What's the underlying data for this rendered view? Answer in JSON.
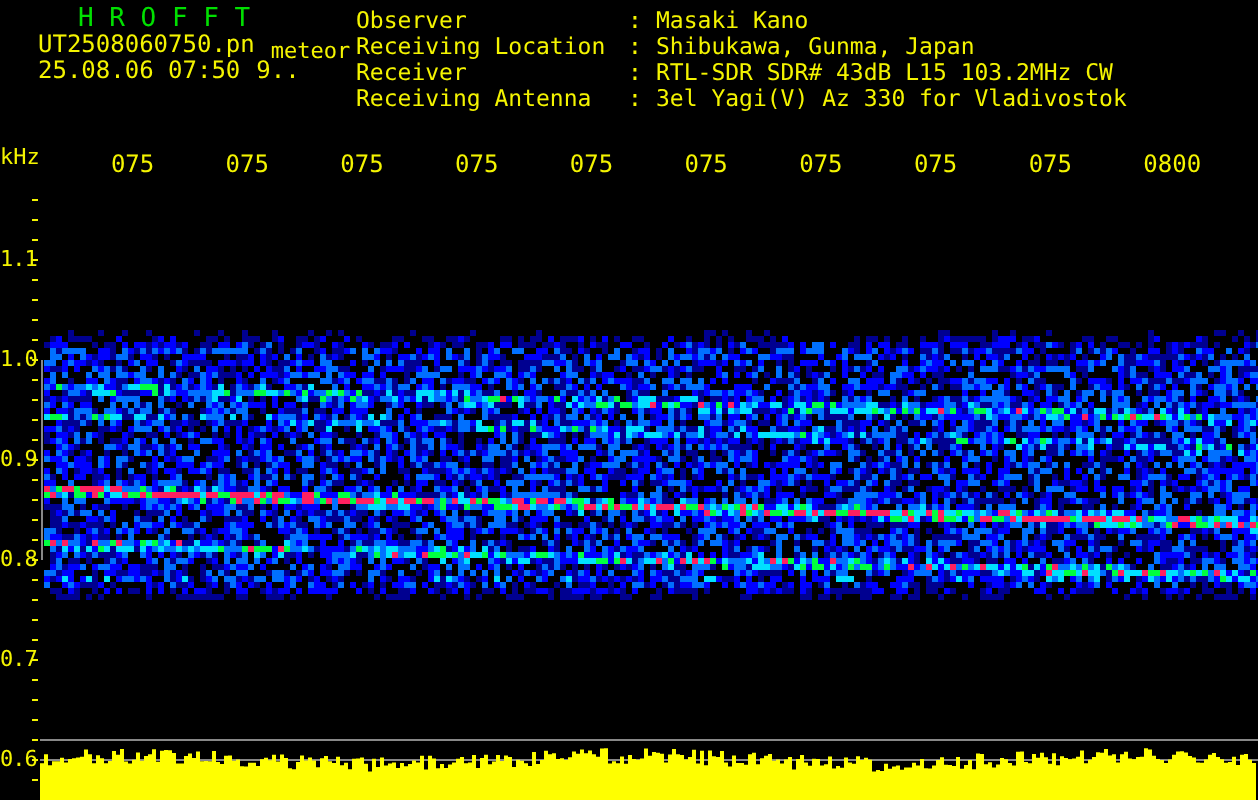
{
  "header": {
    "title": "H R O F F T",
    "filename": "UT2508060750.pn",
    "tag": "meteor",
    "timestamp": "25.08.06 07:50",
    "note": "9.."
  },
  "info": [
    {
      "label": "Observer",
      "separator": ":",
      "value": "Masaki Kano"
    },
    {
      "label": "Receiving Location",
      "separator": ":",
      "value": "Shibukawa, Gunma, Japan"
    },
    {
      "label": "Receiver",
      "separator": ":",
      "value": "RTL-SDR SDR# 43dB L15 103.2MHz CW"
    },
    {
      "label": "Receiving Antenna",
      "separator": ":",
      "value": "3el Yagi(V) Az 330 for Vladivostok"
    }
  ],
  "x_axis": {
    "unit": "kHz",
    "labels": [
      "075",
      "075",
      "075",
      "075",
      "075",
      "075",
      "075",
      "075",
      "075",
      "0800"
    ]
  },
  "y_axis": {
    "labels": [
      "1.1",
      "1.0",
      "0.9",
      "0.8",
      "0.7",
      "0.6"
    ]
  }
}
